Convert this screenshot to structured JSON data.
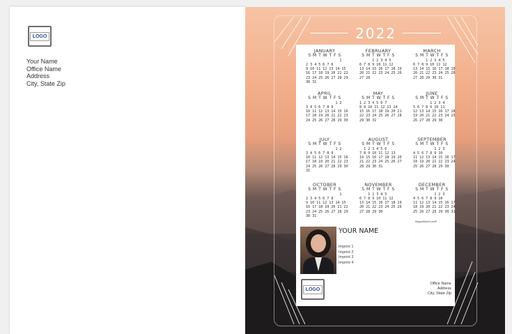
{
  "left": {
    "logo": "LOGO",
    "address_lines": [
      "Your Name",
      "Office Name",
      "Address",
      "City, State Zip"
    ]
  },
  "card": {
    "year": "2022",
    "months": [
      {
        "name": "JANUARY",
        "days": "S M T W T F S",
        "nums": [
          "                1",
          "2 3 4 5 6 7 8",
          "9 10 11 12 13 14 15",
          "16 17 18 19 20 21 22",
          "23 24 25 26 27 28 29",
          "30 31"
        ]
      },
      {
        "name": "FEBRUARY",
        "days": "S M T W T F S",
        "nums": [
          "      1 2 3 4 5",
          "6 7 8 9 10 11 12",
          "13 14 15 16 17 18 19",
          "20 21 22 23 24 25 26",
          "27 28"
        ]
      },
      {
        "name": "MARCH",
        "days": "S M T W T F S",
        "nums": [
          "      1 2 3 4 5",
          "6 7 8 9 10 11 12",
          "13 14 15 16 17 18 19",
          "20 21 22 23 24 25 26",
          "27 28 29 30 31"
        ]
      },
      {
        "name": "APRIL",
        "days": "S M T W T F S",
        "nums": [
          "              1 2",
          "3 4 5 6 7 8 9",
          "10 11 12 13 14 15 16",
          "17 18 19 20 21 22 23",
          "24 25 26 27 28 29 30"
        ]
      },
      {
        "name": "MAY",
        "days": "S M T W T F S",
        "nums": [
          "1 2 3 4 5 6 7",
          "8 9 10 11 12 13 14",
          "15 16 17 18 19 20 21",
          "22 23 24 25 26 27 28",
          "29 30 31"
        ]
      },
      {
        "name": "JUNE",
        "days": "S M T W T F S",
        "nums": [
          "        1 2 3 4",
          "5 6 7 8 9 10 11",
          "12 13 14 15 16 17 18",
          "19 20 21 22 23 24 25",
          "26 27 28 29 30"
        ]
      },
      {
        "name": "JULY",
        "days": "S M T W T F S",
        "nums": [
          "              1 2",
          "3 4 5 6 7 8 9",
          "10 11 12 13 14 15 16",
          "17 18 19 20 21 22 23",
          "24 25 26 27 28 29 30",
          "31"
        ]
      },
      {
        "name": "AUGUST",
        "days": "S M T W T F S",
        "nums": [
          "  1 2 3 4 5 6",
          "7 8 9 10 11 12 13",
          "14 15 16 17 18 19 20",
          "21 22 23 24 25 26 27",
          "28 29 30 31"
        ]
      },
      {
        "name": "SEPTEMBER",
        "days": "S M T W T F S",
        "nums": [
          "          1 2 3",
          "4 5 6 7 8 9 10",
          "11 12 13 14 15 16 17",
          "18 19 20 21 22 23 24",
          "25 26 27 28 29 30"
        ]
      },
      {
        "name": "OCTOBER",
        "days": "S M T W T F S",
        "nums": [
          "                1",
          "2 3 4 5 6 7 8",
          "9 10 11 12 13 14 15",
          "16 17 18 19 20 21 22",
          "23 24 25 26 27 28 29",
          "30 31"
        ]
      },
      {
        "name": "NOVEMBER",
        "days": "S M T W T F S",
        "nums": [
          "    1 2 3 4 5",
          "6 7 8 9 10 11 12",
          "13 14 15 16 17 18 19",
          "20 21 22 23 24 25 26",
          "27 28 29 30"
        ]
      },
      {
        "name": "DECEMBER",
        "days": "S M T W T F S",
        "nums": [
          "          1 2 3",
          "4 5 6 7 8 9 10",
          "11 12 13 14 15 16 17",
          "18 19 20 21 22 23 24",
          "25 26 27 28 29 30 31"
        ]
      }
    ],
    "site": "MagnetStreet.com®",
    "your_name": "YOUR NAME",
    "imprints": [
      "Imprint 1",
      "Imprint 2",
      "Imprint 3",
      "Imprint 4"
    ],
    "logo": "LOGO",
    "address_lines": [
      "Office Name",
      "Address",
      "City, State Zip"
    ]
  }
}
